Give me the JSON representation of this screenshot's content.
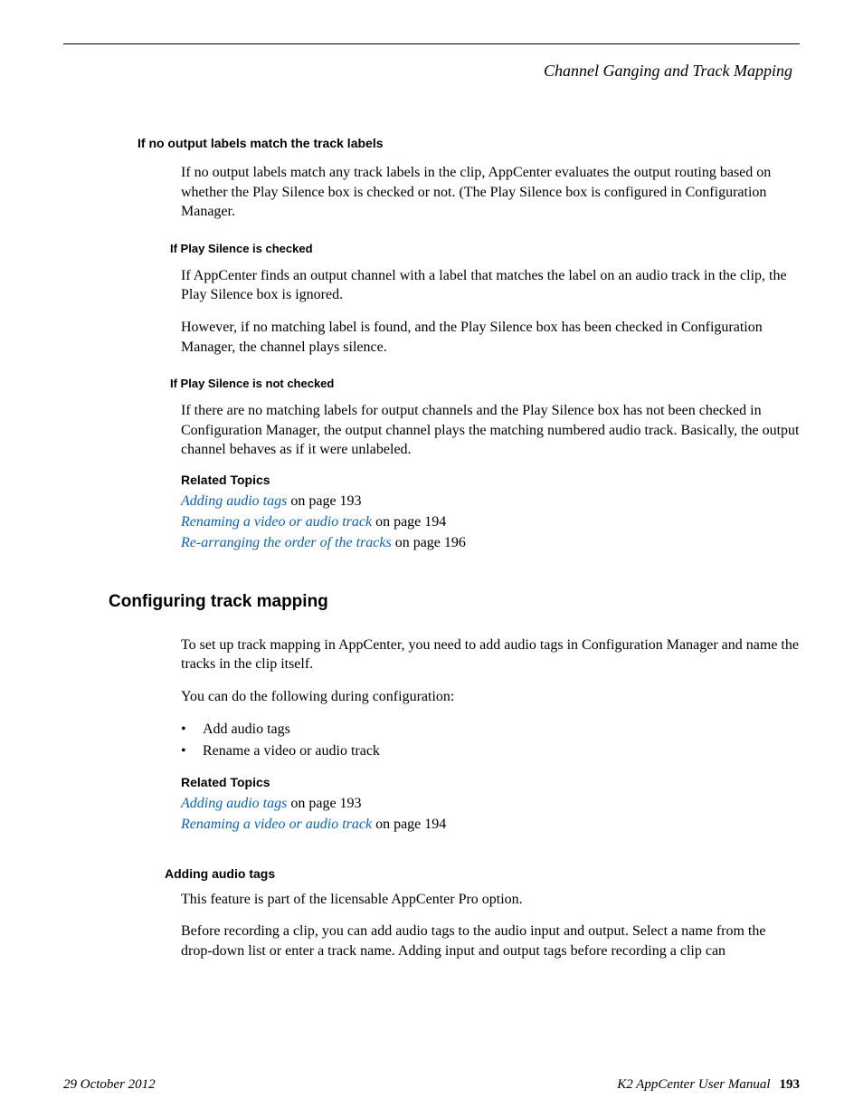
{
  "header": {
    "right": "Channel Ganging and Track Mapping"
  },
  "sec1": {
    "heading": "If no output labels match the track labels",
    "para": "If no output labels match any track labels in the clip, AppCenter evaluates the output routing based on whether the Play Silence box is checked or not. (The Play Silence box is configured in Configuration Manager."
  },
  "sec2": {
    "heading": "If Play Silence is checked",
    "para1": "If AppCenter finds an output channel with a label that matches the label on an audio track in the clip, the Play Silence box is ignored.",
    "para2": "However, if no matching label is found, and the Play Silence box has been checked in Configuration Manager, the channel plays silence."
  },
  "sec3": {
    "heading": "If Play Silence is not checked",
    "para": "If there are no matching labels for output channels and the Play Silence box has not been checked in Configuration Manager, the output channel plays the matching numbered audio track. Basically, the output channel behaves as if it were unlabeled."
  },
  "related": {
    "heading": "Related Topics",
    "items": [
      {
        "link": "Adding audio tags",
        "suffix": " on page 193"
      },
      {
        "link": "Renaming a video or audio track",
        "suffix": " on page 194"
      },
      {
        "link": "Re-arranging the order of the tracks",
        "suffix": " on page 196"
      }
    ]
  },
  "config": {
    "heading": "Configuring track mapping",
    "para1": "To set up track mapping in AppCenter, you need to add audio tags in Configuration Manager and name the tracks in the clip itself.",
    "para2": "You can do the following during configuration:",
    "bullets": [
      "Add audio tags",
      "Rename a video or audio track"
    ]
  },
  "related2": {
    "heading": "Related Topics",
    "items": [
      {
        "link": "Adding audio tags",
        "suffix": " on page 193"
      },
      {
        "link": "Renaming a video or audio track",
        "suffix": " on page 194"
      }
    ]
  },
  "adding": {
    "heading": "Adding audio tags",
    "para1": "This feature is part of the licensable AppCenter Pro option.",
    "para2": "Before recording a clip, you can add audio tags to the audio input and output. Select a name from the drop-down list or enter a track name. Adding input and output tags before recording a clip can"
  },
  "footer": {
    "left": "29 October 2012",
    "right": "K2 AppCenter User Manual",
    "page": "193"
  }
}
